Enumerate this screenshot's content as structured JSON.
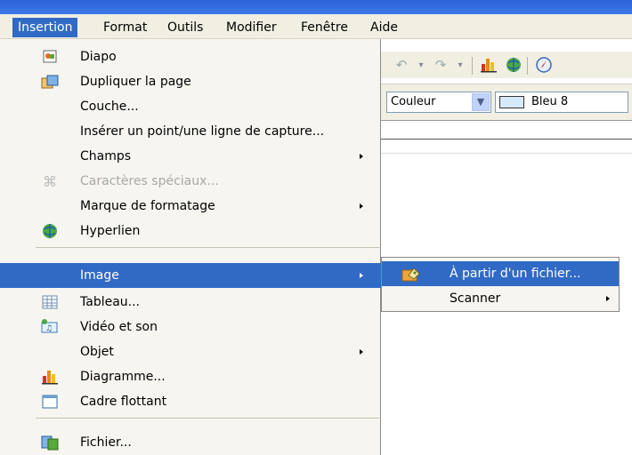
{
  "menubar": {
    "items": [
      {
        "label": "Insertion",
        "active": true
      },
      {
        "label": "Format"
      },
      {
        "label": "Outils"
      },
      {
        "label": "Modifier"
      },
      {
        "label": "Fenêtre"
      },
      {
        "label": "Aide"
      }
    ]
  },
  "toolbar": {
    "line_style_value": "Couleur",
    "fill_color_value": "Bleu 8",
    "fill_color_swatch": "#d6e9f8"
  },
  "insert_menu": {
    "items": [
      {
        "label": "Diapo",
        "icon": "slide-icon"
      },
      {
        "label": "Dupliquer la page",
        "icon": "duplicate-page-icon"
      },
      {
        "label": "Couche...",
        "icon": ""
      },
      {
        "label": "Insérer un point/une ligne de capture...",
        "icon": ""
      },
      {
        "label": "Champs",
        "icon": "",
        "submenu": true
      },
      {
        "label": "Caractères spéciaux...",
        "icon": "special-characters-icon",
        "disabled": true
      },
      {
        "label": "Marque de formatage",
        "icon": "",
        "submenu": true
      },
      {
        "label": "Hyperlien",
        "icon": "hyperlink-icon"
      },
      {
        "label": "Image",
        "icon": "",
        "submenu": true,
        "selected": true
      },
      {
        "label": "Tableau...",
        "icon": "table-icon"
      },
      {
        "label": "Vidéo et son",
        "icon": "video-sound-icon"
      },
      {
        "label": "Objet",
        "icon": "",
        "submenu": true
      },
      {
        "label": "Diagramme...",
        "icon": "chart-icon"
      },
      {
        "label": "Cadre flottant",
        "icon": "floating-frame-icon"
      },
      {
        "label": "Fichier...",
        "icon": "file-icon"
      }
    ]
  },
  "image_submenu": {
    "items": [
      {
        "label": "À partir d'un fichier...",
        "icon": "image-from-file-icon",
        "selected": true
      },
      {
        "label": "Scanner",
        "submenu": true
      }
    ]
  },
  "colors": {
    "selection": "#316ac5",
    "menu_bg": "#f6f5f0",
    "titlebar": "#2b63d8"
  }
}
